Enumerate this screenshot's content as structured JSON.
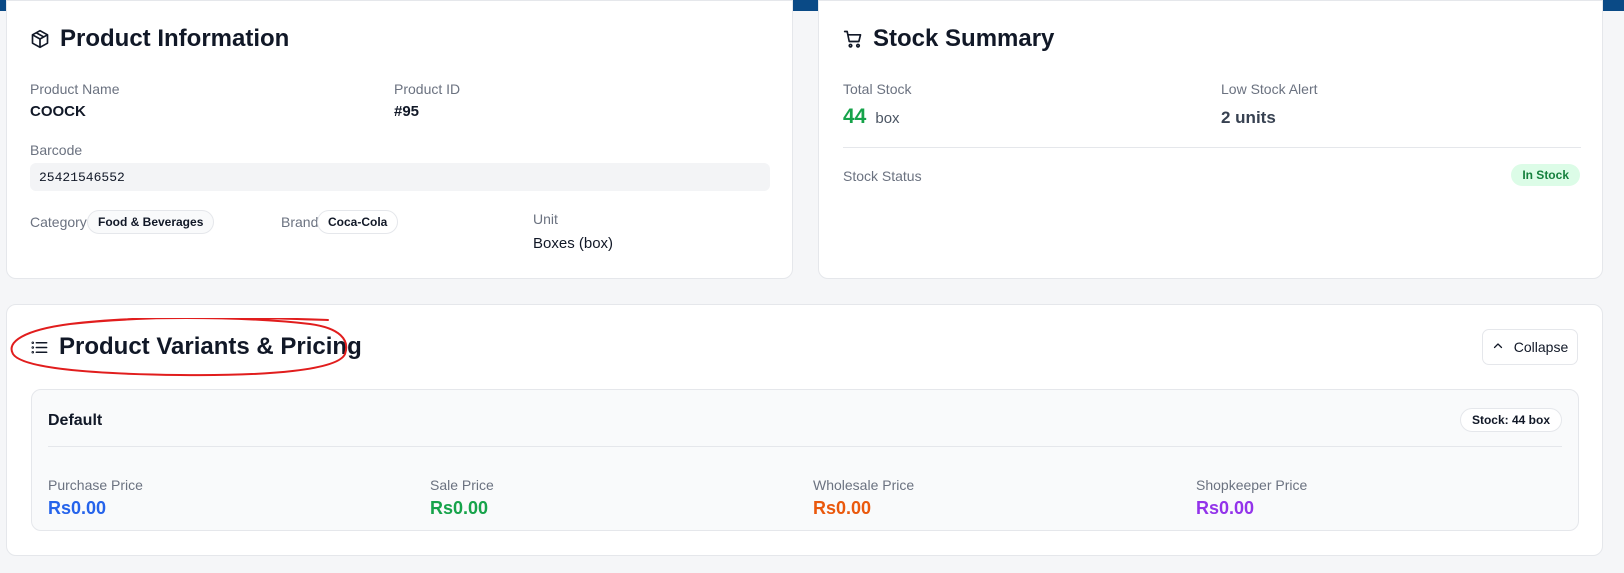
{
  "product_info": {
    "title": "Product Information",
    "icon": "package-icon",
    "product_name_label": "Product Name",
    "product_name": "COOCK",
    "product_id_label": "Product ID",
    "product_id": "#95",
    "barcode_label": "Barcode",
    "barcode": "25421546552",
    "category_label": "Category",
    "category": "Food & Beverages",
    "brand_label": "Brand",
    "brand": "Coca-Cola",
    "unit_label": "Unit",
    "unit": "Boxes (box)"
  },
  "stock_summary": {
    "title": "Stock Summary",
    "icon": "cart-icon",
    "total_stock_label": "Total Stock",
    "total_stock_value": "44",
    "total_stock_unit": "box",
    "low_stock_label": "Low Stock Alert",
    "low_stock_value": "2 units",
    "status_label": "Stock Status",
    "status_badge": "In Stock"
  },
  "variants": {
    "title": "Product Variants & Pricing",
    "icon": "list-icon",
    "collapse_label": "Collapse",
    "items": [
      {
        "name": "Default",
        "stock": "Stock: 44 box",
        "purchase_label": "Purchase Price",
        "purchase_value": "Rs0.00",
        "sale_label": "Sale Price",
        "sale_value": "Rs0.00",
        "wholesale_label": "Wholesale Price",
        "wholesale_value": "Rs0.00",
        "shopkeeper_label": "Shopkeeper Price",
        "shopkeeper_value": "Rs0.00"
      }
    ]
  },
  "colors": {
    "header_bar": "#0a4a86",
    "stock_green": "#16a34a",
    "purchase_blue": "#2563eb",
    "sale_green": "#16a34a",
    "wholesale_orange": "#ea580c",
    "shopkeeper_purple": "#9333ea",
    "annotation_red": "#e11d1d"
  }
}
